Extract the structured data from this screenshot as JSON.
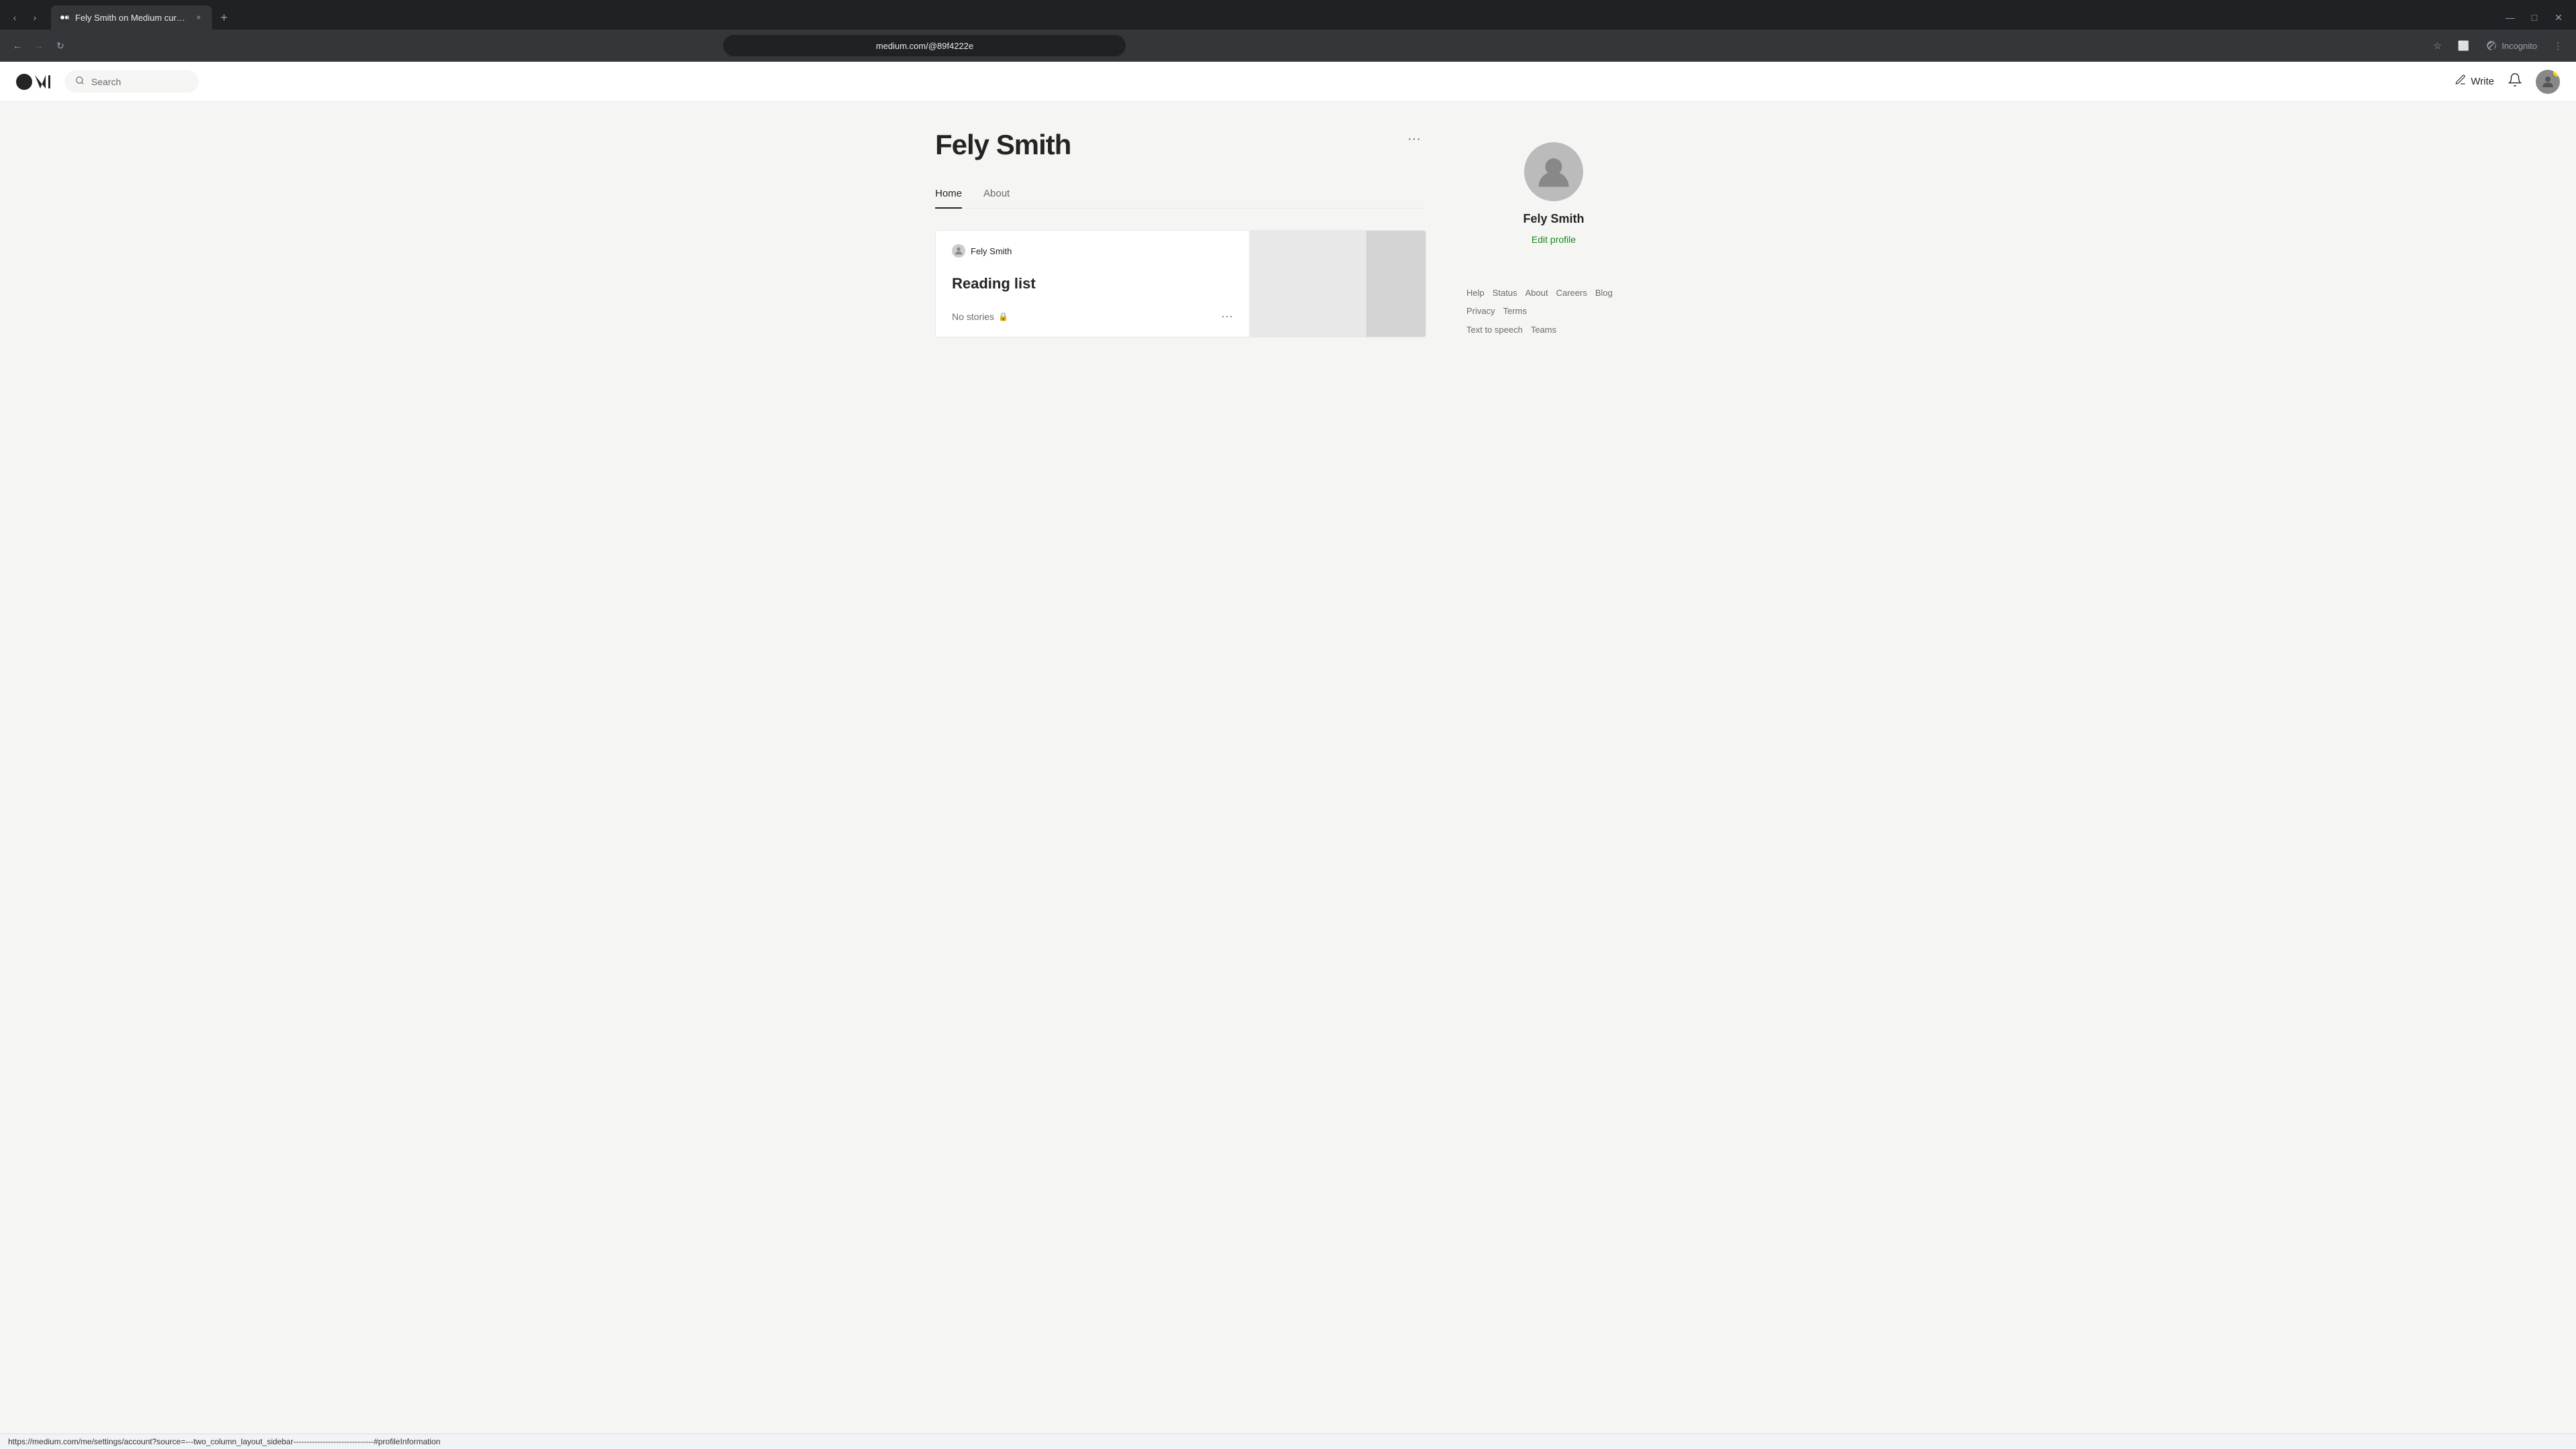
{
  "browser": {
    "tab": {
      "title": "Fely Smith on Medium curated",
      "favicon": "M",
      "close_label": "×"
    },
    "new_tab_label": "+",
    "window_controls": {
      "minimize": "—",
      "maximize": "□",
      "close": "✕"
    },
    "address_bar": {
      "url": "medium.com/@89f4222e",
      "back_label": "←",
      "forward_label": "→",
      "reload_label": "↻",
      "star_label": "☆",
      "layout_label": "⬜",
      "incognito_label": "Incognito",
      "menu_label": "⋮"
    }
  },
  "nav": {
    "logo_label": "Medium",
    "search_placeholder": "Search",
    "write_label": "Write",
    "notification_label": "🔔",
    "avatar_label": "A"
  },
  "profile": {
    "name": "Fely Smith",
    "more_label": "···",
    "tabs": [
      {
        "label": "Home",
        "active": true
      },
      {
        "label": "About",
        "active": false
      }
    ]
  },
  "reading_list": {
    "author": "Fely Smith",
    "title": "Reading list",
    "no_stories_label": "No stories",
    "more_label": "···"
  },
  "sidebar": {
    "name": "Fely Smith",
    "edit_profile_label": "Edit profile"
  },
  "footer": {
    "links": [
      "Help",
      "Status",
      "About",
      "Careers",
      "Blog",
      "Privacy",
      "Terms",
      "Text to speech",
      "Teams"
    ]
  },
  "status_bar": {
    "url": "https://medium.com/me/settings/account?source=---two_column_layout_sidebar------------------------------#profileInformation"
  }
}
